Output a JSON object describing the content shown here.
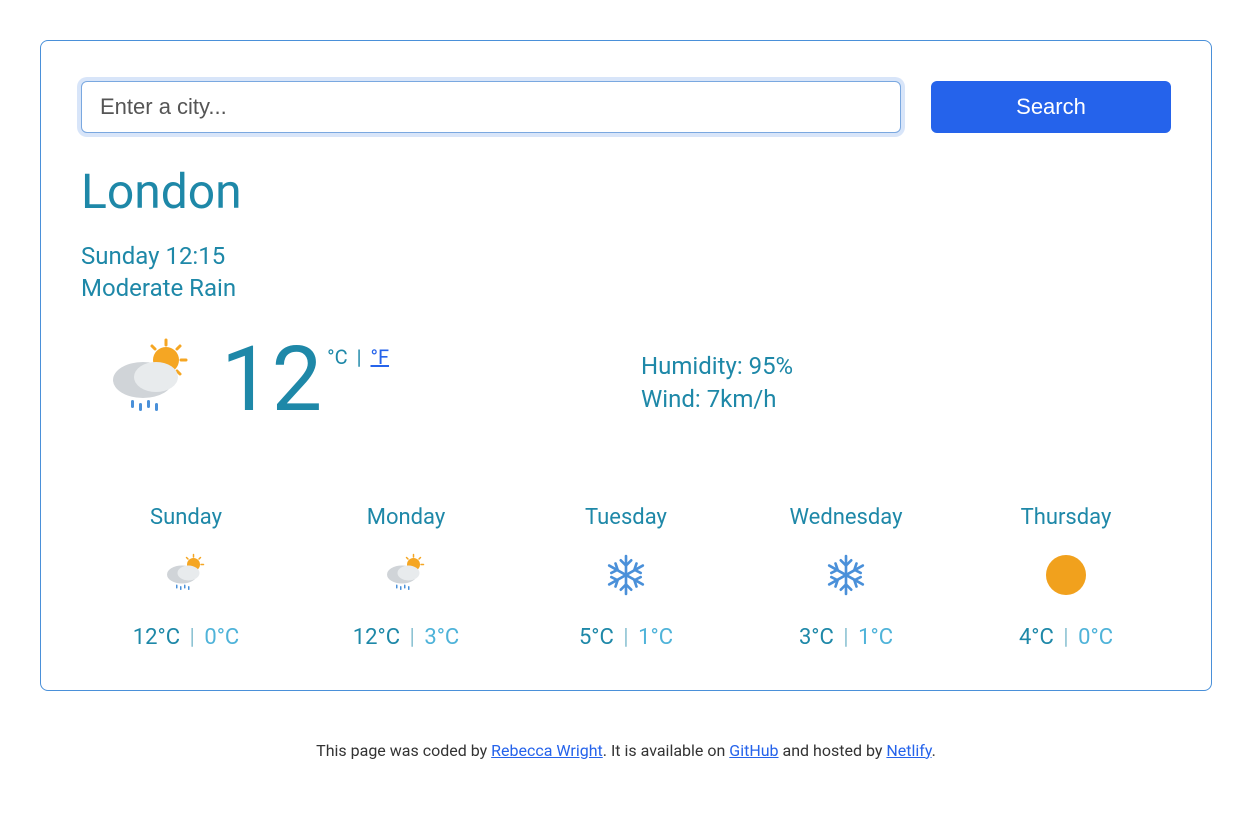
{
  "search": {
    "placeholder": "Enter a city...",
    "button_label": "Search"
  },
  "current": {
    "city": "London",
    "datetime": "Sunday 12:15",
    "condition": "Moderate Rain",
    "temp": "12",
    "unit_c": "°C",
    "unit_sep": "|",
    "unit_f": "°F",
    "humidity_label": "Humidity: ",
    "humidity_value": "95%",
    "wind_label": "Wind: ",
    "wind_value": "7km/h",
    "icon": "partly-sunny-rain"
  },
  "forecast": [
    {
      "day": "Sunday",
      "icon": "partly-sunny-rain",
      "high": "12°C",
      "low": "0°C"
    },
    {
      "day": "Monday",
      "icon": "partly-sunny-rain",
      "high": "12°C",
      "low": "3°C"
    },
    {
      "day": "Tuesday",
      "icon": "snowflake",
      "high": "5°C",
      "low": "1°C"
    },
    {
      "day": "Wednesday",
      "icon": "snowflake",
      "high": "3°C",
      "low": "1°C"
    },
    {
      "day": "Thursday",
      "icon": "sun",
      "high": "4°C",
      "low": "0°C"
    }
  ],
  "footer": {
    "text1": "This page was coded by ",
    "author": "Rebecca Wright",
    "text2": ". It is available on ",
    "link2": "GitHub",
    "text3": " and hosted by ",
    "link3": "Netlify",
    "text4": "."
  }
}
